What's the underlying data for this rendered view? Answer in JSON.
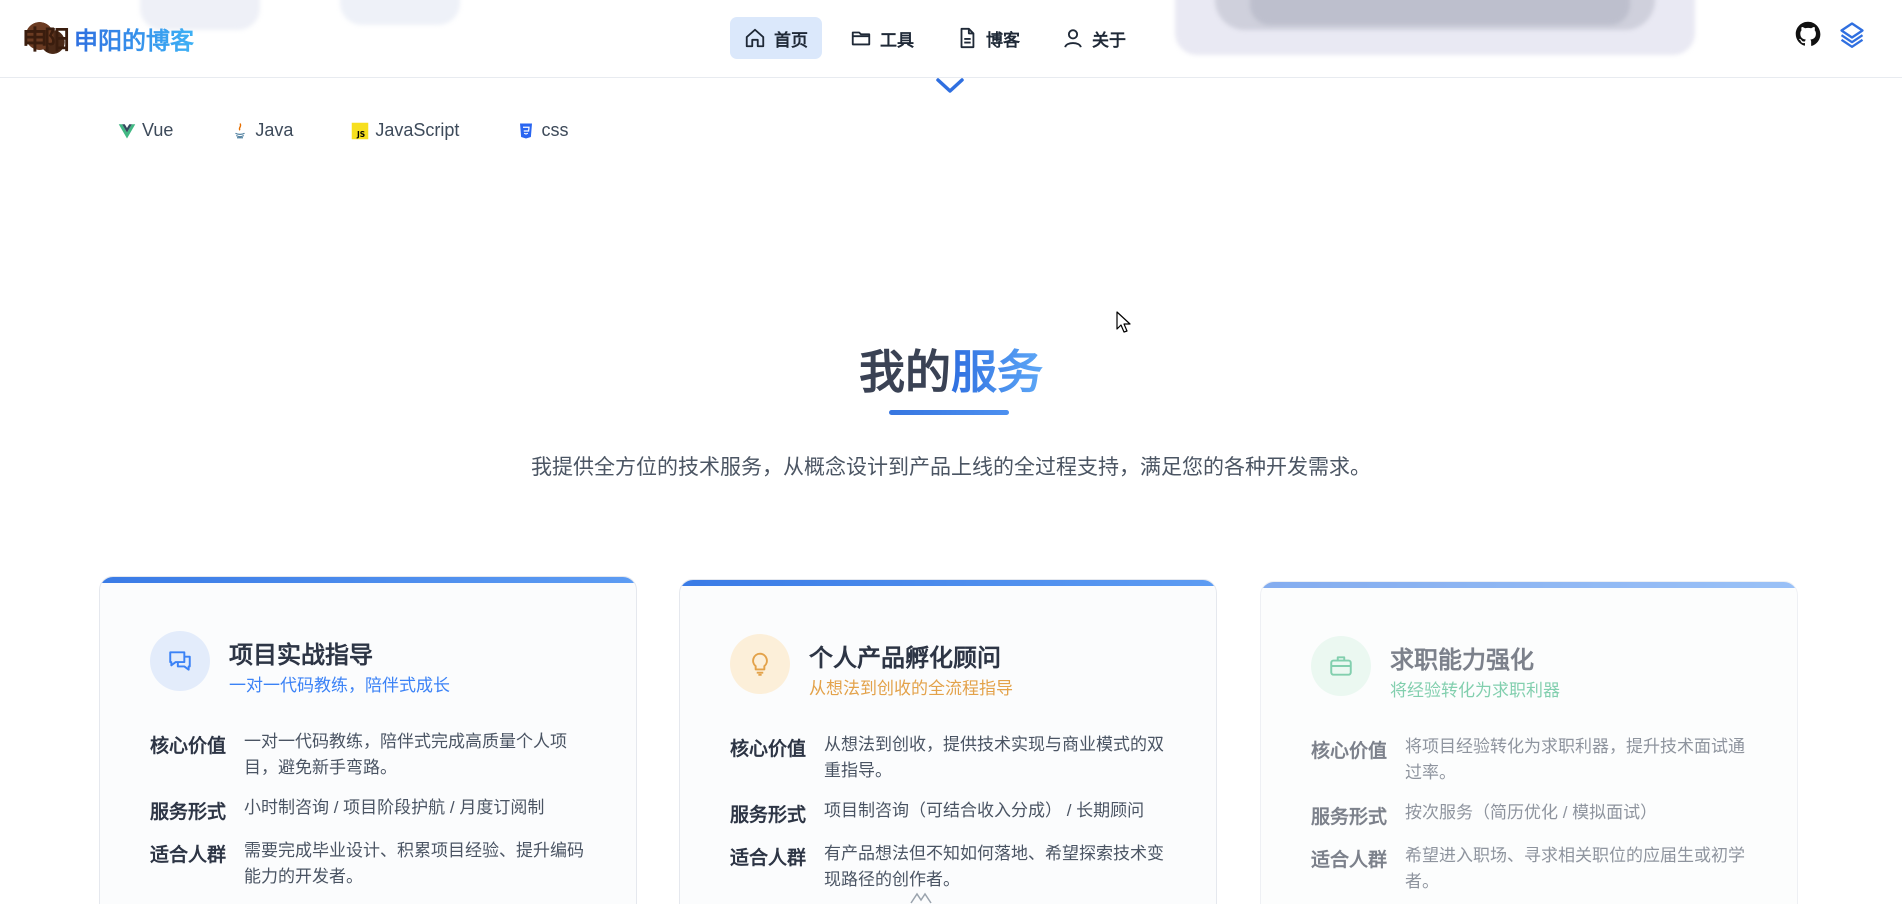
{
  "brand": {
    "name": "申阳的博客",
    "logo_glyph": "申阳"
  },
  "nav": [
    {
      "label": "首页",
      "icon": "home-icon",
      "active": true
    },
    {
      "label": "工具",
      "icon": "folder-icon",
      "active": false
    },
    {
      "label": "博客",
      "icon": "document-icon",
      "active": false
    },
    {
      "label": "关于",
      "icon": "user-icon",
      "active": false
    }
  ],
  "header_icons": [
    "github-icon",
    "layers-icon"
  ],
  "tags": [
    {
      "label": "Vue",
      "icon": "vue-icon"
    },
    {
      "label": "Java",
      "icon": "java-icon"
    },
    {
      "label": "JavaScript",
      "icon": "javascript-icon"
    },
    {
      "label": "css",
      "icon": "css-icon"
    }
  ],
  "section": {
    "title_plain": "我的",
    "title_highlight": "服务",
    "subtitle": "我提供全方位的技术服务，从概念设计到产品上线的全过程支持，满足您的各种开发需求。"
  },
  "cards": [
    {
      "title": "项目实战指导",
      "subtitle": "一对一代码教练，陪伴式成长",
      "accent": "#3b82f6",
      "icon": "chat-icon",
      "rows": [
        {
          "k": "核心价值",
          "v": "一对一代码教练，陪伴式完成高质量个人项目，避免新手弯路。"
        },
        {
          "k": "服务形式",
          "v": "小时制咨询 / 项目阶段护航 / 月度订阅制"
        },
        {
          "k": "适合人群",
          "v": "需要完成毕业设计、积累项目经验、提升编码能力的开发者。"
        }
      ]
    },
    {
      "title": "个人产品孵化顾问",
      "subtitle": "从想法到创收的全流程指导",
      "accent": "#e3a24a",
      "icon": "lightbulb-icon",
      "rows": [
        {
          "k": "核心价值",
          "v": "从想法到创收，提供技术实现与商业模式的双重指导。"
        },
        {
          "k": "服务形式",
          "v": "项目制咨询（可结合收入分成） / 长期顾问"
        },
        {
          "k": "适合人群",
          "v": "有产品想法但不知如何落地、希望探索技术变现路径的创作者。"
        }
      ]
    },
    {
      "title": "求职能力强化",
      "subtitle": "将经验转化为求职利器",
      "accent": "#36b37e",
      "icon": "briefcase-icon",
      "rows": [
        {
          "k": "核心价值",
          "v": "将项目经验转化为求职利器，提升技术面试通过率。"
        },
        {
          "k": "服务形式",
          "v": "按次服务（简历优化 / 模拟面试）"
        },
        {
          "k": "适合人群",
          "v": "希望进入职场、寻求相关职位的应届生或初学者。"
        }
      ]
    }
  ]
}
